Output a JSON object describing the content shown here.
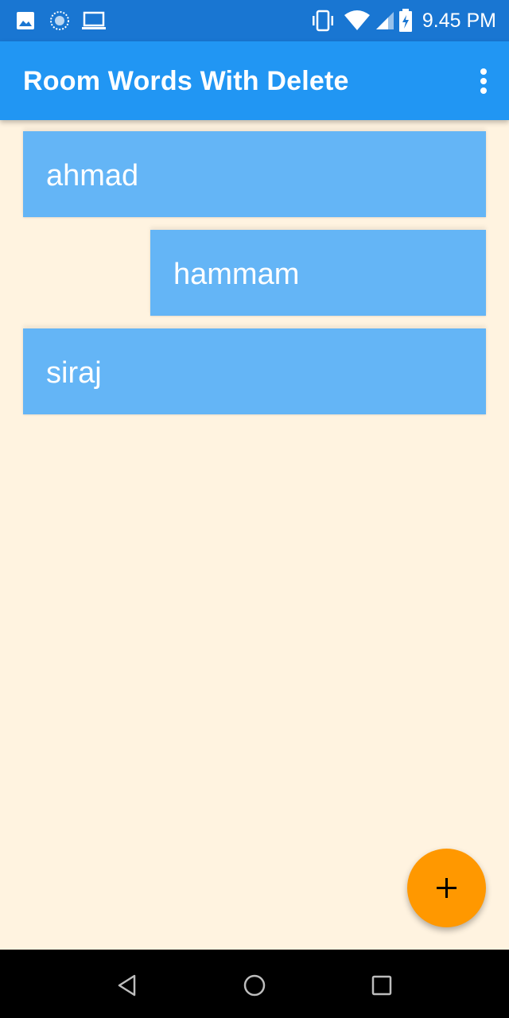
{
  "status_bar": {
    "time": "9.45 PM",
    "icons": [
      "image-icon",
      "sync-icon",
      "laptop-icon",
      "vibrate-icon",
      "wifi-icon",
      "cell-signal-icon",
      "battery-charging-icon"
    ]
  },
  "app_bar": {
    "title": "Room Words With Delete",
    "menu_icon": "overflow-menu-icon"
  },
  "words": [
    {
      "text": "ahmad"
    },
    {
      "text": "hammam"
    },
    {
      "text": "siraj"
    }
  ],
  "fab": {
    "icon": "plus-icon",
    "color": "#FF9800"
  },
  "nav_bar": {
    "icons": [
      "back-icon",
      "home-icon",
      "recents-icon"
    ]
  },
  "colors": {
    "status_bar": "#1976D2",
    "app_bar": "#2196F3",
    "item": "#64B5F6",
    "background": "#FFF3E0"
  }
}
